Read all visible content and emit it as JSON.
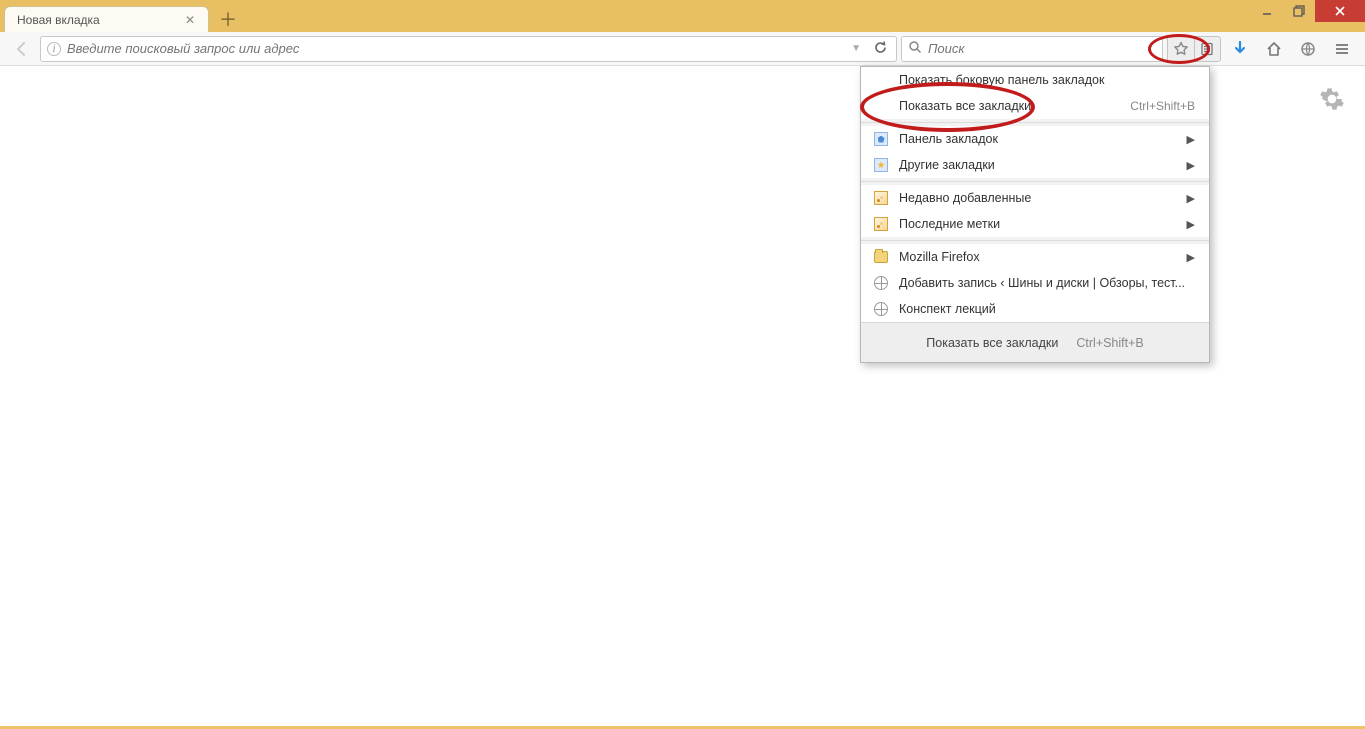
{
  "tabs": [
    {
      "title": "Новая вкладка"
    }
  ],
  "urlbar": {
    "placeholder": "Введите поисковый запрос или адрес"
  },
  "searchbar": {
    "placeholder": "Поиск"
  },
  "bookmarks_menu": {
    "top": [
      {
        "label": "Показать боковую панель закладок",
        "shortcut": "",
        "icon": "none"
      },
      {
        "label": "Показать все закладки",
        "shortcut": "Ctrl+Shift+B",
        "icon": "none"
      }
    ],
    "folders": [
      {
        "label": "Панель закладок",
        "icon": "square-blue",
        "has_submenu": true
      },
      {
        "label": "Другие закладки",
        "icon": "square-star",
        "has_submenu": true
      }
    ],
    "recent": [
      {
        "label": "Недавно добавленные",
        "icon": "rss",
        "has_submenu": true
      },
      {
        "label": "Последние метки",
        "icon": "rss",
        "has_submenu": true
      }
    ],
    "items": [
      {
        "label": "Mozilla Firefox",
        "icon": "folder",
        "has_submenu": true
      },
      {
        "label": "Добавить запись ‹ Шины и диски | Обзоры, тест...",
        "icon": "globe",
        "has_submenu": false
      },
      {
        "label": "Конспект лекций",
        "icon": "globe",
        "has_submenu": false
      }
    ],
    "footer": {
      "label": "Показать все закладки",
      "shortcut": "Ctrl+Shift+B"
    }
  },
  "colors": {
    "titlebar": "#e8bf63",
    "close_btn": "#c73d34",
    "highlight": "#c11b1b",
    "download_arrow": "#2a8ae2"
  }
}
